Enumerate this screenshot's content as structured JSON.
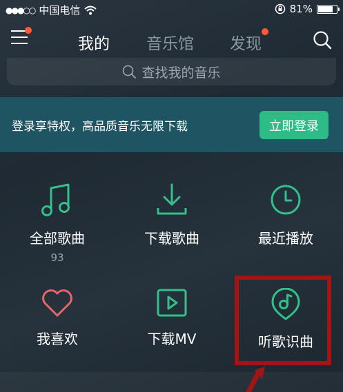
{
  "status_bar": {
    "signal": "●●●○○",
    "carrier": "中国电信",
    "battery": "81%",
    "battery_level": 0.81
  },
  "nav": {
    "tabs": [
      {
        "label": "我的",
        "active": true
      },
      {
        "label": "音乐馆",
        "active": false
      },
      {
        "label": "发现",
        "active": false,
        "badge": true
      }
    ],
    "menu_badge": true
  },
  "search": {
    "placeholder": "查找我的音乐"
  },
  "banner": {
    "text": "登录享特权，高品质音乐无限下载",
    "button_label": "立即登录"
  },
  "grid": [
    {
      "label": "全部歌曲",
      "count": "93",
      "icon": "music-note-icon"
    },
    {
      "label": "下载歌曲",
      "icon": "download-icon"
    },
    {
      "label": "最近播放",
      "icon": "clock-icon"
    },
    {
      "label": "我喜欢",
      "icon": "heart-icon"
    },
    {
      "label": "下载MV",
      "icon": "video-play-icon"
    },
    {
      "label": "听歌识曲",
      "icon": "music-recognize-icon"
    }
  ],
  "colors": {
    "accent_green": "#2dbc86",
    "icon_green": "#33c08a",
    "heart_red": "#e8666b",
    "badge_orange": "#ff5a36",
    "highlight_red": "#a31515",
    "banner_bg": "#1f5462"
  }
}
